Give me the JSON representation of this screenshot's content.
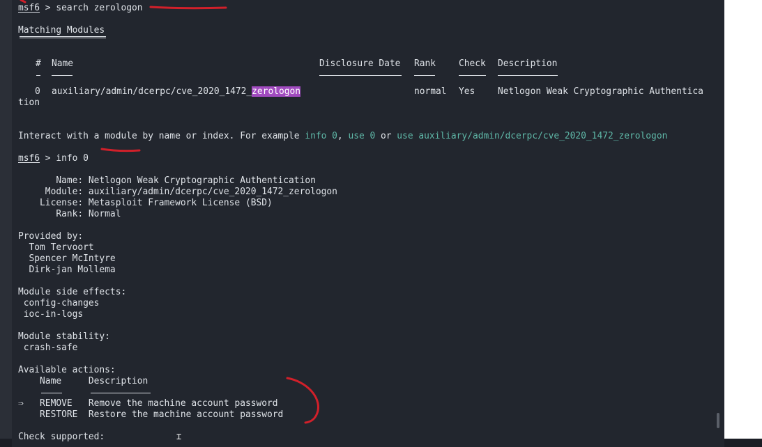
{
  "prompt1": {
    "user": "msf6",
    "rest": " > search zerologon"
  },
  "matching_title": "Matching Modules",
  "table": {
    "headers": {
      "num": "#",
      "name": "Name",
      "date": "Disclosure Date",
      "rank": "Rank",
      "check": "Check",
      "desc": "Description"
    },
    "row": {
      "num": "0",
      "name_prefix": "auxiliary/admin/dcerpc/cve_2020_1472_",
      "name_highlight": "zerologon",
      "rank": "normal",
      "check": "Yes",
      "desc": "Netlogon Weak Cryptographic Authentica",
      "desc_wrap": "tion"
    }
  },
  "interact": {
    "pre": "Interact with a module by name or index. For example ",
    "info_cmd": "info 0",
    "sep1": ", ",
    "use_cmd": "use 0",
    "sep2": " or ",
    "use_full": "use auxiliary/admin/dcerpc/cve_2020_1472_zerologon"
  },
  "prompt2": {
    "user": "msf6",
    "rest": " > info 0"
  },
  "info": {
    "name": "       Name: Netlogon Weak Cryptographic Authentication",
    "module": "     Module: auxiliary/admin/dcerpc/cve_2020_1472_zerologon",
    "license": "    License: Metasploit Framework License (BSD)",
    "rank": "       Rank: Normal"
  },
  "provided_by": {
    "title": "Provided by:",
    "authors": [
      "  Tom Tervoort",
      "  Spencer McIntyre",
      "  Dirk-jan Mollema"
    ]
  },
  "side_effects": {
    "title": "Module side effects:",
    "items": [
      " config-changes",
      " ioc-in-logs"
    ]
  },
  "stability": {
    "title": "Module stability:",
    "items": [
      " crash-safe"
    ]
  },
  "actions": {
    "title": "Available actions:",
    "header": "    Name     Description",
    "rows": [
      {
        "marker": "⇒",
        "text": "   REMOVE   Remove the machine account password"
      },
      {
        "marker": "",
        "text": "    RESTORE  Restore the machine account password"
      }
    ]
  },
  "check_supported": "Check supported:",
  "annotation_color": "#d1202a",
  "highlight_color": "#a14bbf",
  "command_color": "#5fb8a8"
}
